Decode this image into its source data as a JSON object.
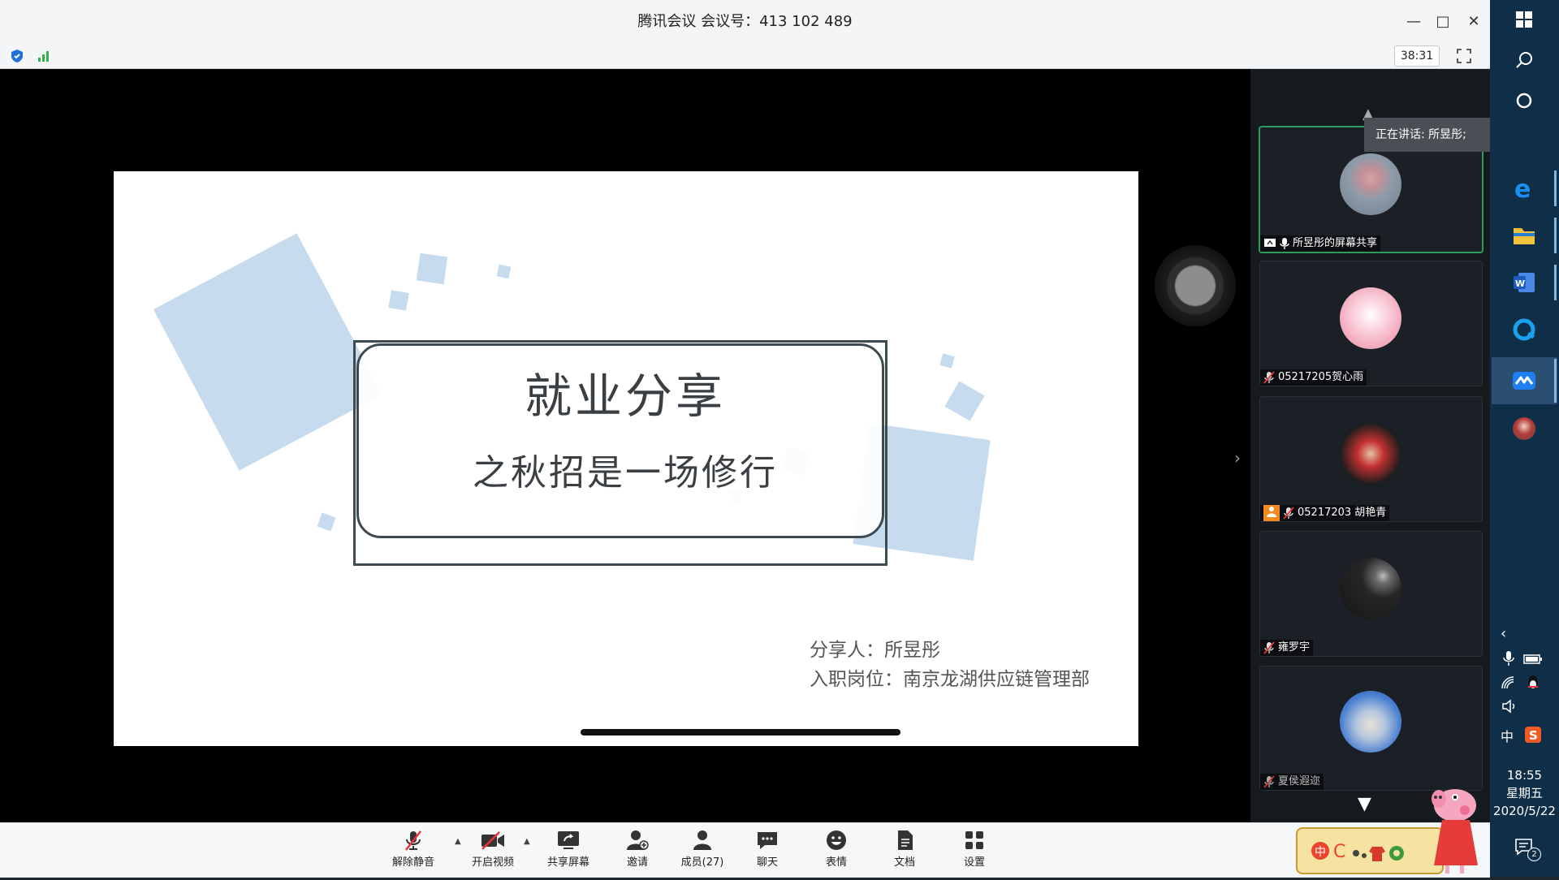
{
  "window": {
    "title": "腾讯会议 会议号：413 102 489",
    "timer": "38:31"
  },
  "slide": {
    "title": "就业分享",
    "subtitle": "之秋招是一场修行",
    "sharer": "分享人：所昱彤",
    "position": "入职岗位：南京龙湖供应链管理部"
  },
  "sidebar": {
    "speaking": "正在讲话: 所昱彤;",
    "participants": [
      {
        "label": "所昱彤的屏幕共享",
        "avatar_color": "#9aa7b6",
        "muted": false,
        "sharing": true
      },
      {
        "label": "05217205贺心雨",
        "avatar_color": "#f4b9c9",
        "muted": true
      },
      {
        "label": "05217203 胡艳青",
        "avatar_color": "#b5222e",
        "muted": true,
        "video_off_badge": true
      },
      {
        "label": "雍罗宇",
        "avatar_color": "#2a2a2a",
        "muted": true
      },
      {
        "label": "夏侯遐迩",
        "avatar_color": "#3f72c2",
        "muted": true
      }
    ]
  },
  "toolbar": {
    "buttons": [
      {
        "label": "解除静音",
        "icon": "mic-muted-icon"
      },
      {
        "label": "开启视频",
        "icon": "camera-off-icon"
      },
      {
        "label": "共享屏幕",
        "icon": "share-screen-icon"
      },
      {
        "label": "邀请",
        "icon": "invite-user-icon"
      },
      {
        "label": "成员(27)",
        "icon": "members-icon"
      },
      {
        "label": "聊天",
        "icon": "chat-icon"
      },
      {
        "label": "表情",
        "icon": "emoji-icon"
      },
      {
        "label": "文档",
        "icon": "document-icon"
      },
      {
        "label": "设置",
        "icon": "settings-icon"
      }
    ]
  },
  "taskbar": {
    "ime": "中",
    "time": "18:55",
    "weekday": "星期五",
    "date": "2020/5/22",
    "notification_count": "2"
  },
  "colors": {
    "accent_green": "#2e9c5e",
    "slide_shape": "#c7dbef",
    "taskbar": "#0f2f48"
  }
}
